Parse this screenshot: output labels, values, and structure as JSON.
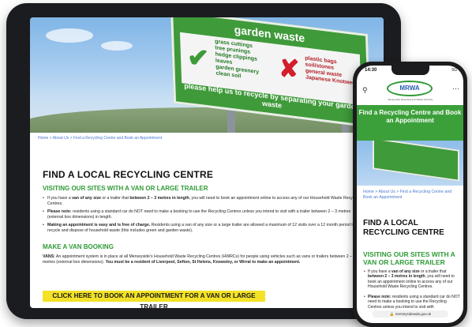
{
  "tablet": {
    "hero": {
      "sign_title": "garden waste",
      "accepted": [
        "grass cuttings",
        "tree prunings",
        "hedge clippings",
        "leaves",
        "garden greenery",
        "clean soil"
      ],
      "rejected": [
        "plastic bags",
        "soil/stones",
        "general waste",
        "Japanese Knotweed"
      ],
      "sign_footer": "please help us to recycle by separating your garden waste"
    },
    "breadcrumb": "Home > About Us > Find a Recycling Centre and Book an Appointment",
    "heading": "FIND A LOCAL RECYCLING CENTRE",
    "subheading": "VISITING OUR SITES WITH A VAN OR LARGE TRAILER",
    "bullets": [
      {
        "pre": "If you have a ",
        "b1": "van of any size",
        "mid": " or a trailer that ",
        "b2": "between 2 – 3 metres in length",
        "post": ", you will need to book an appointment online to access any of our Household Waste Recycling Centres."
      },
      {
        "b1": "Please note:",
        "post": " residents using a standard car do NOT need to make a booking to use the Recycling Centres unless you intend to visit with a trailer between 2 – 3 metres (external box dimensions) in length."
      },
      {
        "b1": "Making an appointment is easy and is free of charge.",
        "post": " Residents using a van of any size or a large trailer are allowed a maximum of 12 visits over a 12 month period to recycle and dispose of household waste (this includes green and garden waste)."
      }
    ],
    "subheading2": "MAKE A VAN BOOKING",
    "vans_label": "VANS:",
    "vans_text": " An appointment system is in place at all Merseyside's Household Waste Recycling Centres (HWRCs) for people using vehicles such as vans or trailers between 2 – 3 metres (external box dimensions). ",
    "vans_bold": "You must be a resident of Liverpool, Sefton, St Helens, Knowsley, or Wirral to make an appointment.",
    "cta_label": "CLICK HERE TO BOOK AN APPOINTMENT FOR A VAN OR LARGE TRAILER"
  },
  "phone": {
    "time": "14:30",
    "status_right": "5G",
    "logo_text": "MRWA",
    "logo_sub": "Merseyside Recycling and Waste Authority",
    "banner": "Find a Recycling Centre and Book an Appointment",
    "breadcrumb": "Home > About Us > Find a Recycling Centre and Book an Appointment",
    "heading": "FIND A LOCAL RECYCLING CENTRE",
    "subheading": "VISITING OUR SITES WITH A VAN OR LARGE TRAILER",
    "bullet1_pre": "If you have a ",
    "bullet1_b1": "van of any size",
    "bullet1_mid": " or a trailer that ",
    "bullet1_b2": "between 2 – 3 metres in length",
    "bullet1_post": ", you will need to book an appointment online to access any of our Household Waste Recycling Centres.",
    "bullet2_b": "Please note:",
    "bullet2_post": " residents using a standard car do NOT need to make a booking to use the Recycling Centres unless you intend to visit with",
    "url": "merseysidewda.gov.uk"
  },
  "colors": {
    "brand_green": "#3ca03a",
    "cta_yellow": "#f3e225",
    "link_blue": "#4a7ad0"
  },
  "icons": {
    "search": "search-icon",
    "menu": "more-icon",
    "lock": "lock-icon"
  }
}
